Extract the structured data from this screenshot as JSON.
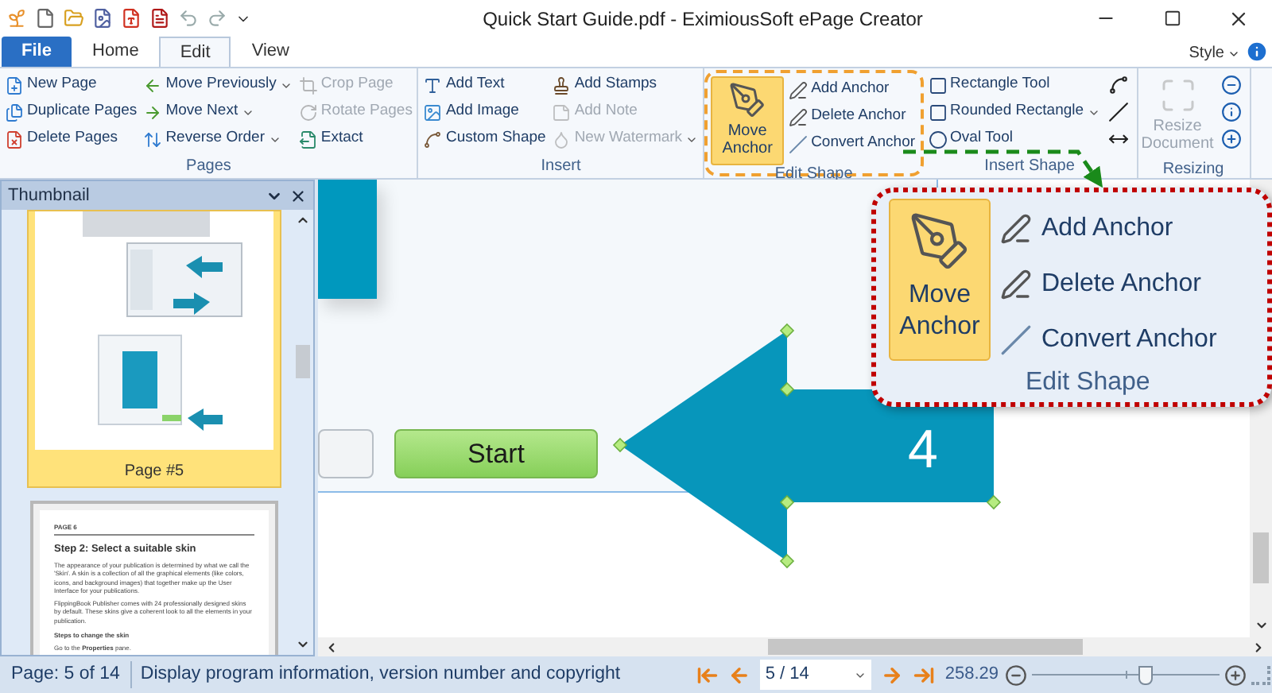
{
  "window": {
    "title": "Quick Start Guide.pdf - EximiousSoft ePage Creator"
  },
  "tabs": [
    {
      "label": "File",
      "kind": "file",
      "selected": false
    },
    {
      "label": "Home",
      "kind": "tab",
      "selected": false
    },
    {
      "label": "Edit",
      "kind": "tab",
      "selected": true
    },
    {
      "label": "View",
      "kind": "tab",
      "selected": false
    }
  ],
  "style_menu": {
    "label": "Style"
  },
  "ribbon": {
    "groups": [
      {
        "label": "Pages",
        "highlighted": false,
        "columns": [
          [
            {
              "kind": "small",
              "label": "New Page",
              "disabled": false,
              "dropdown": false
            },
            {
              "kind": "small",
              "label": "Duplicate Pages",
              "disabled": false,
              "dropdown": false
            },
            {
              "kind": "small",
              "label": "Delete Pages",
              "disabled": false,
              "dropdown": false
            }
          ],
          [
            {
              "kind": "small",
              "label": "Move Previously",
              "disabled": false,
              "dropdown": true
            },
            {
              "kind": "small",
              "label": "Move Next",
              "disabled": false,
              "dropdown": true
            },
            {
              "kind": "small",
              "label": "Reverse Order",
              "disabled": false,
              "dropdown": true
            }
          ],
          [
            {
              "kind": "small",
              "label": "Crop Page",
              "disabled": true,
              "dropdown": false
            },
            {
              "kind": "small",
              "label": "Rotate Pages",
              "disabled": true,
              "dropdown": false
            },
            {
              "kind": "small",
              "label": "Extact",
              "disabled": false,
              "dropdown": false
            }
          ]
        ]
      },
      {
        "label": "Insert",
        "highlighted": false,
        "columns": [
          [
            {
              "kind": "small",
              "label": "Add Text",
              "disabled": false,
              "dropdown": false
            },
            {
              "kind": "small",
              "label": "Add Image",
              "disabled": false,
              "dropdown": false
            },
            {
              "kind": "small",
              "label": "Custom Shape",
              "disabled": false,
              "dropdown": false
            }
          ],
          [
            {
              "kind": "small",
              "label": "Add Stamps",
              "disabled": false,
              "dropdown": false
            },
            {
              "kind": "small",
              "label": "Add Note",
              "disabled": true,
              "dropdown": false
            },
            {
              "kind": "small",
              "label": "New Watermark",
              "disabled": true,
              "dropdown": true
            }
          ]
        ]
      },
      {
        "label": "Edit Shape",
        "highlighted": true,
        "columns": [
          [
            {
              "kind": "large",
              "label": "Move Anchor",
              "disabled": false,
              "selected": true
            }
          ],
          [
            {
              "kind": "small",
              "label": "Add Anchor",
              "disabled": false,
              "dropdown": false,
              "selected": false
            },
            {
              "kind": "small",
              "label": "Delete Anchor",
              "disabled": false,
              "dropdown": false,
              "selected": false
            },
            {
              "kind": "small",
              "label": "Convert Anchor",
              "disabled": false,
              "dropdown": false,
              "selected": false
            }
          ]
        ]
      },
      {
        "label": "Insert Shape",
        "highlighted": false,
        "columns": [
          [
            {
              "kind": "small",
              "label": "Rectangle Tool",
              "disabled": false,
              "dropdown": false
            },
            {
              "kind": "small",
              "label": "Rounded Rectangle",
              "disabled": false,
              "dropdown": true
            },
            {
              "kind": "small",
              "label": "Oval Tool",
              "disabled": false,
              "dropdown": false
            }
          ],
          [
            {
              "kind": "icon",
              "disabled": false
            },
            {
              "kind": "icon",
              "disabled": false
            },
            {
              "kind": "icon",
              "disabled": false
            }
          ]
        ]
      },
      {
        "label": "Resizing",
        "highlighted": false,
        "columns": [
          [
            {
              "kind": "large",
              "label": "Resize Document",
              "disabled": true
            }
          ],
          [
            {
              "kind": "icon",
              "disabled": false
            },
            {
              "kind": "icon",
              "disabled": false
            },
            {
              "kind": "icon",
              "disabled": false
            }
          ]
        ]
      }
    ]
  },
  "thumbnail_panel": {
    "title": "Thumbnail",
    "pages": [
      {
        "kind": "picture",
        "label": "Page #5",
        "selected": true
      },
      {
        "kind": "text",
        "selected": false,
        "heading": "PAGE 6",
        "title": "Step 2: Select a suitable skin",
        "paragraphs": [
          "The appearance of your publication is determined by what we call the 'Skin'. A skin is a collection of all the graphical elements (like colors, icons, and background images) that together make up the User Interface for your publications.",
          "FlippingBook Publisher comes with 24 professionally designed skins by default. These skins give a coherent look to all the elements in your publication."
        ],
        "subheading": "Steps to change the skin",
        "step": "Go to the **Properties** pane."
      }
    ]
  },
  "document": {
    "start_button": "Start",
    "arrow_label": "4"
  },
  "callout": {
    "group_label": "Edit Shape",
    "items": [
      {
        "kind": "large",
        "label": "Move Anchor",
        "selected": true
      },
      {
        "kind": "small",
        "label": "Add Anchor",
        "selected": false
      },
      {
        "kind": "small",
        "label": "Delete Anchor",
        "selected": false
      },
      {
        "kind": "small",
        "label": "Convert Anchor",
        "selected": false
      }
    ]
  },
  "status_bar": {
    "page_info": "Page: 5 of 14",
    "message": "Display program information, version number and copyright",
    "page_field": "5 / 14",
    "zoom": "258.29",
    "zoom_slider": {
      "level": 0.6
    }
  }
}
